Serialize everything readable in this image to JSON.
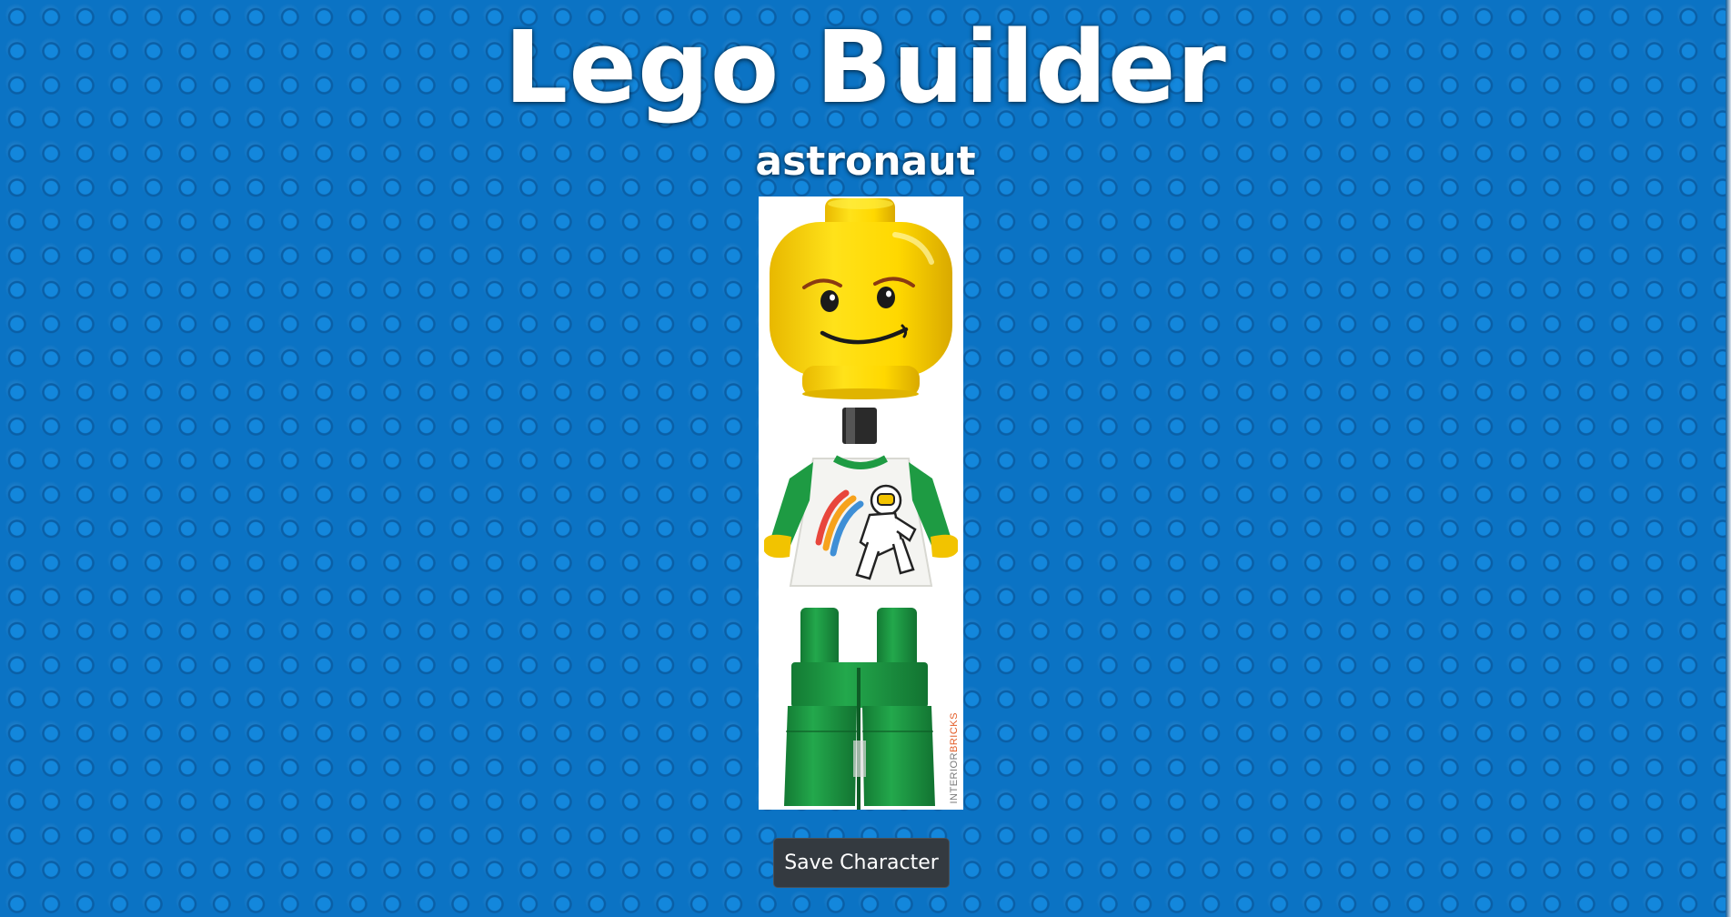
{
  "page": {
    "title": "Lego Builder",
    "character_name": "astronaut"
  },
  "figure": {
    "watermark_text_1": "INTERIOR",
    "watermark_text_2": "BRICKS",
    "head_icon": "lego-head-icon",
    "torso_icon": "lego-torso-astronaut-icon",
    "legs_icon": "lego-legs-icon"
  },
  "actions": {
    "save_label": "Save Character"
  },
  "colors": {
    "background": "#0b73c4",
    "head": "#ffd800",
    "torso": "#f4f4f1",
    "arms": "#1e9b43",
    "legs": "#1e9b43",
    "button": "#343a40"
  }
}
